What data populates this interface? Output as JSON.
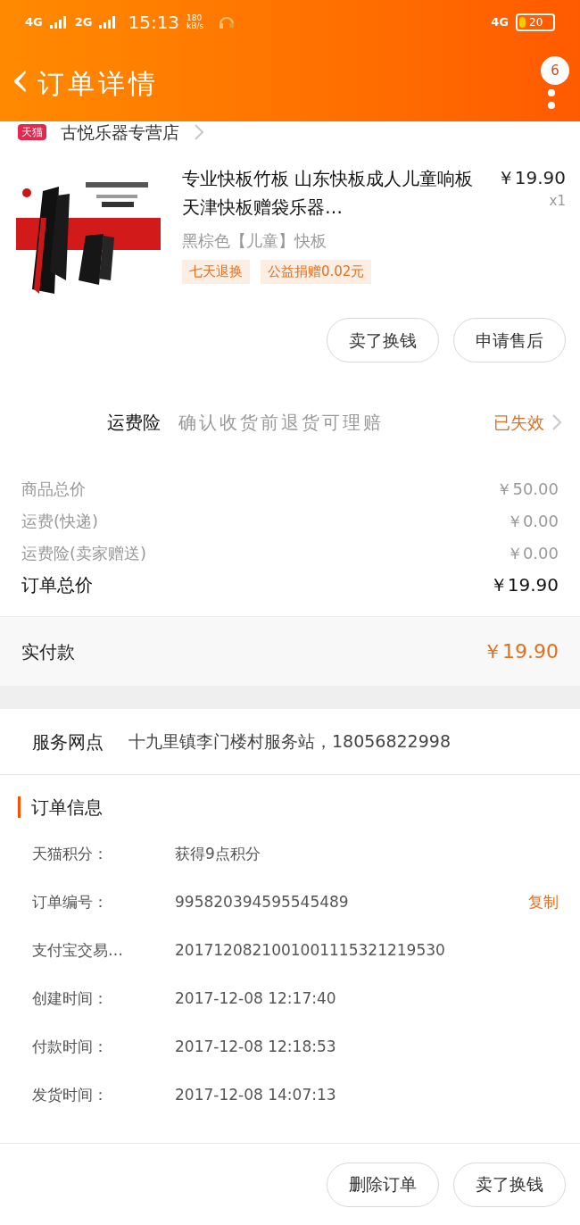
{
  "status_bar": {
    "network_1": "4G",
    "network_2": "2G",
    "time": "15:13",
    "speed_value": "180",
    "speed_unit": "kB/s",
    "network_right": "4G",
    "battery": "20"
  },
  "nav": {
    "back": "‹",
    "title": "订单详情",
    "badge": "6"
  },
  "store": {
    "tag": "天猫",
    "name": "古悦乐器专营店"
  },
  "product": {
    "title": "专业快板竹板 山东快板成人儿童响板天津快板赠袋乐器…",
    "price": "￥19.90",
    "quantity": "x1",
    "sku": "黑棕色【儿童】快板",
    "tags": [
      "七天退换",
      "公益捐赠0.02元"
    ]
  },
  "item_buttons": [
    "卖了换钱",
    "申请售后"
  ],
  "insurance": {
    "label": "运费险",
    "description": "确认收货前退货可理赔",
    "status": "已失效"
  },
  "costs": [
    {
      "label": "商品总价",
      "value": "￥50.00",
      "emphasis": false
    },
    {
      "label": "运费(快递)",
      "value": "￥0.00",
      "emphasis": false
    },
    {
      "label": "运费险(卖家赠送)",
      "value": "￥0.00",
      "emphasis": false
    },
    {
      "label": "订单总价",
      "value": "￥19.90",
      "emphasis": true
    }
  ],
  "paid": {
    "label": "实付款",
    "value": "￥19.90"
  },
  "service": {
    "label": "服务网点",
    "value": "十九里镇李门楼村服务站，18056822998"
  },
  "order_info": {
    "title": "订单信息",
    "rows": [
      {
        "label": "天猫积分：",
        "value": "获得9点积分"
      },
      {
        "label": "订单编号：",
        "value": "995820394595545489",
        "action": "复制"
      },
      {
        "label": "支付宝交易…",
        "value": "2017120821001001115321219530"
      },
      {
        "label": "创建时间：",
        "value": "2017-12-08 12:17:40"
      },
      {
        "label": "付款时间：",
        "value": "2017-12-08 12:18:53"
      },
      {
        "label": "发货时间：",
        "value": "2017-12-08 14:07:13"
      }
    ]
  },
  "bottom_buttons": [
    "删除订单",
    "卖了换钱"
  ]
}
